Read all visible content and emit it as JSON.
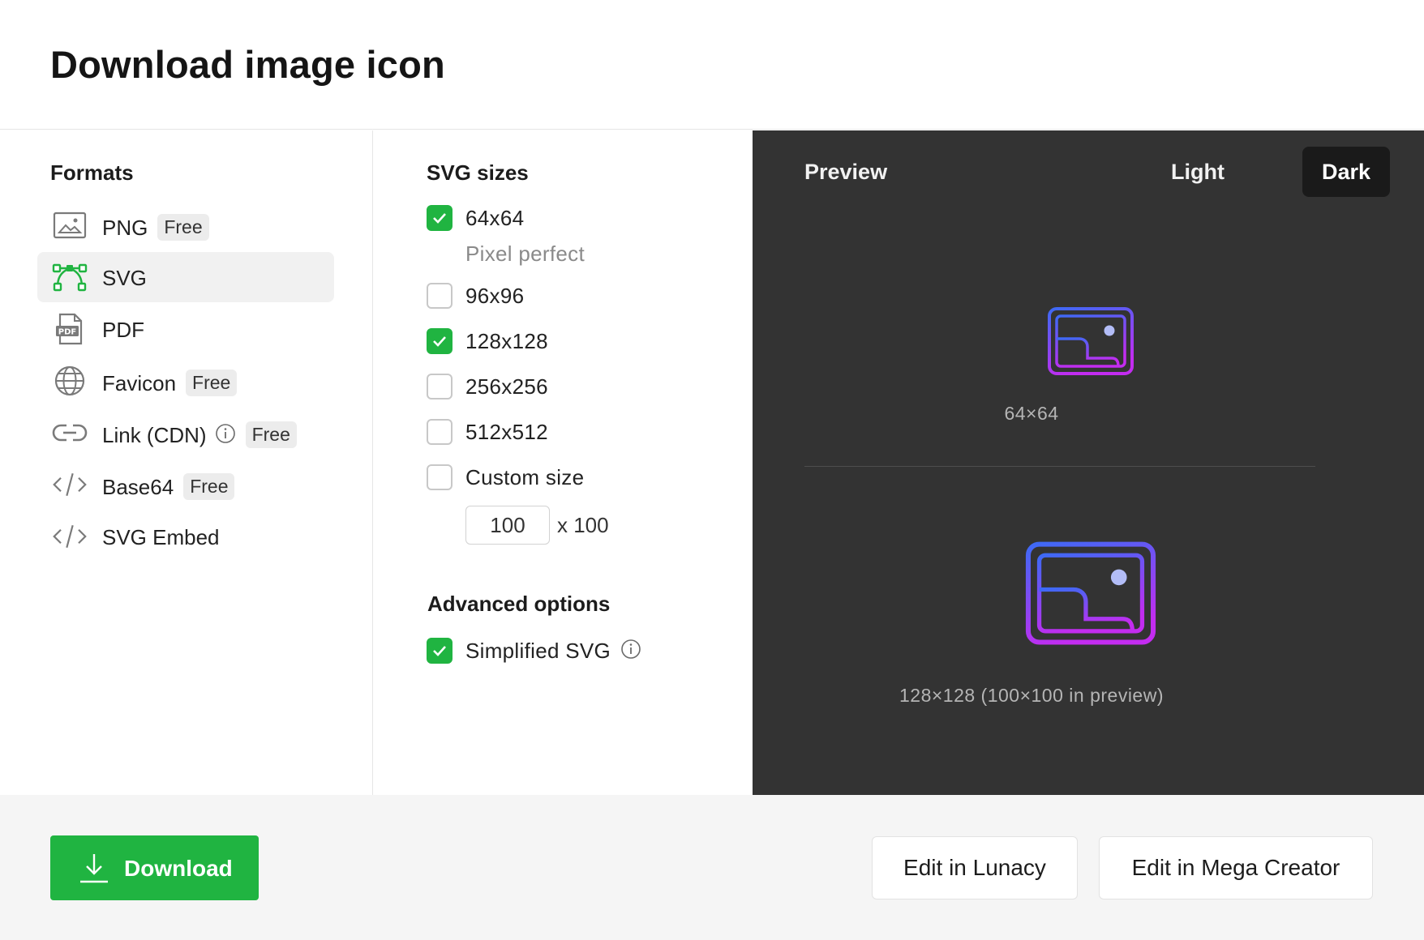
{
  "dialog": {
    "title": "Download image icon"
  },
  "formats": {
    "title": "Formats",
    "items": [
      {
        "label": "PNG",
        "badge": "Free",
        "icon": "image-icon"
      },
      {
        "label": "SVG",
        "badge": "",
        "icon": "vector-pen-icon",
        "selected": true
      },
      {
        "label": "PDF",
        "badge": "",
        "icon": "pdf-file-icon"
      },
      {
        "label": "Favicon",
        "badge": "Free",
        "icon": "globe-icon"
      },
      {
        "label": "Link (CDN)",
        "badge": "Free",
        "icon": "link-icon"
      },
      {
        "label": "Base64",
        "badge": "Free",
        "icon": "code-icon"
      },
      {
        "label": "SVG Embed",
        "badge": "",
        "icon": "code-icon"
      }
    ]
  },
  "sizes": {
    "title": "SVG sizes",
    "options": [
      {
        "label": "64x64",
        "sub": "Pixel perfect",
        "checked": true
      },
      {
        "label": "96x96",
        "checked": false
      },
      {
        "label": "128x128",
        "checked": true
      },
      {
        "label": "256x256",
        "checked": false
      },
      {
        "label": "512x512",
        "checked": false
      },
      {
        "label": "Custom size",
        "checked": false
      }
    ],
    "custom_width": "100",
    "custom_height_text": "x 100"
  },
  "advanced": {
    "title": "Advanced options",
    "simplified_svg": {
      "label": "Simplified SVG",
      "checked": true
    }
  },
  "preview": {
    "title": "Preview",
    "modes": [
      "Light",
      "Dark"
    ],
    "active_mode": "Dark",
    "captions": [
      "64×64",
      "128×128 (100×100 in preview)"
    ]
  },
  "footer": {
    "download_label": "Download",
    "lunacy_label": "Edit in Lunacy",
    "mega_label": "Edit in Mega Creator"
  },
  "colors": {
    "accent_green": "#20b441",
    "preview_bg": "#333333",
    "icon_gradient_start": "#3d6af5",
    "icon_gradient_end": "#c32cf0"
  }
}
